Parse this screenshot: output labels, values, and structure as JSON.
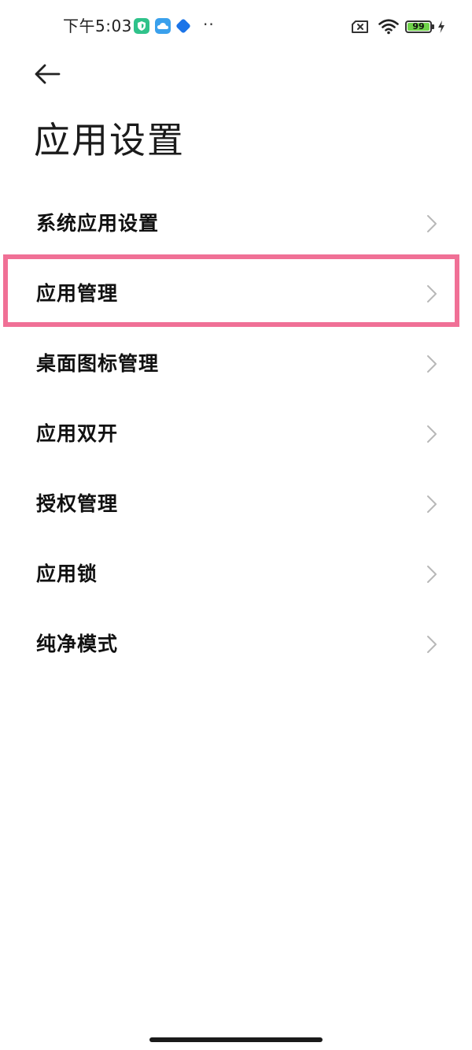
{
  "status_bar": {
    "time": "下午5:03",
    "more": "··",
    "battery_level": "99",
    "icons": [
      "shield-app-icon",
      "cloud-app-icon",
      "diamond-app-icon",
      "no-sim-icon",
      "wifi-icon",
      "battery-icon",
      "charging-bolt-icon"
    ],
    "battery_color": "#6fd34a"
  },
  "header": {
    "back_icon": "arrow-left-icon",
    "title": "应用设置"
  },
  "menu": {
    "items": [
      {
        "label": "系统应用设置",
        "icon": "chevron-right-icon"
      },
      {
        "label": "应用管理",
        "icon": "chevron-right-icon",
        "highlighted": true
      },
      {
        "label": "桌面图标管理",
        "icon": "chevron-right-icon"
      },
      {
        "label": "应用双开",
        "icon": "chevron-right-icon"
      },
      {
        "label": "授权管理",
        "icon": "chevron-right-icon"
      },
      {
        "label": "应用锁",
        "icon": "chevron-right-icon"
      },
      {
        "label": "纯净模式",
        "icon": "chevron-right-icon"
      }
    ]
  },
  "colors": {
    "highlight": "#f07096",
    "chevron": "#b8b8b8",
    "text": "#111111"
  }
}
